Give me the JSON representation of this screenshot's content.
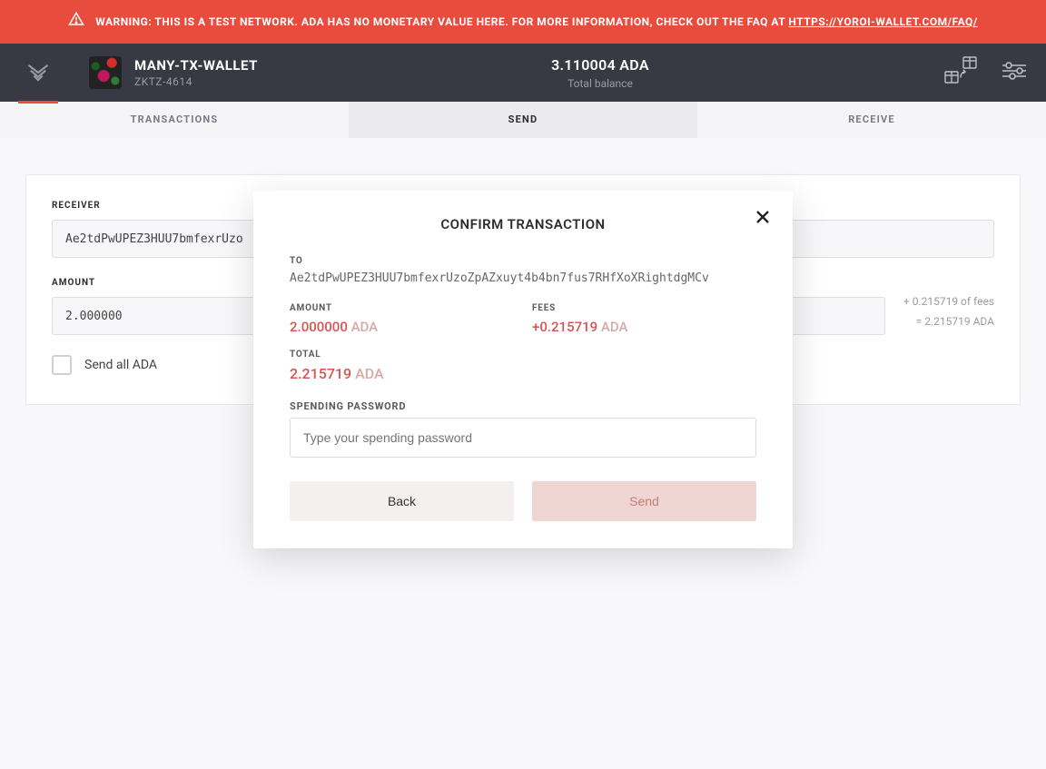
{
  "warning": {
    "text_prefix": "WARNING: THIS IS A TEST NETWORK. ADA HAS NO MONETARY VALUE HERE. FOR MORE INFORMATION, CHECK OUT THE FAQ AT ",
    "link": "HTTPS://YOROI-WALLET.COM/FAQ/"
  },
  "header": {
    "wallet_name": "MANY-TX-WALLET",
    "wallet_sub": "ZKTZ-4614",
    "balance": "3.110004 ADA",
    "balance_label": "Total balance"
  },
  "tabs": {
    "transactions": "TRANSACTIONS",
    "send": "SEND",
    "receive": "RECEIVE"
  },
  "form": {
    "receiver_label": "RECEIVER",
    "receiver_value": "Ae2tdPwUPEZ3HUU7bmfexrUzo",
    "amount_label": "AMOUNT",
    "amount_value": "2.000000",
    "fees_text": "+ 0.215719 of fees",
    "eq_text": "= 2.215719 ADA",
    "send_all": "Send all ADA"
  },
  "modal": {
    "title": "CONFIRM TRANSACTION",
    "to_label": "TO",
    "to_value": "Ae2tdPwUPEZ3HUU7bmfexrUzoZpAZxuyt4b4bn7fus7RHfXoXRightdgMCv",
    "amount_label": "AMOUNT",
    "amount_value": "2.000000",
    "fees_label": "FEES",
    "fees_value": "+0.215719",
    "total_label": "TOTAL",
    "total_value": "2.215719",
    "ada": "ADA",
    "password_label": "SPENDING PASSWORD",
    "password_placeholder": "Type your spending password",
    "back": "Back",
    "send": "Send"
  }
}
